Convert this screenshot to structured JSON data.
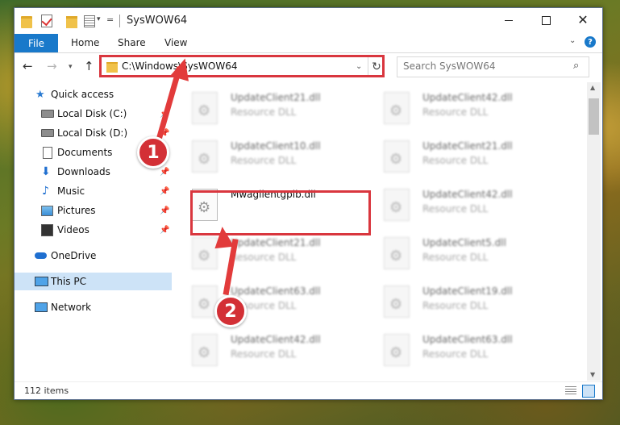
{
  "window": {
    "title": "SysWOW64",
    "controls": {
      "minimize": "minimize-icon",
      "maximize": "maximize-icon",
      "close": "close-icon"
    }
  },
  "ribbon": {
    "tabs": [
      "File",
      "Home",
      "Share",
      "View"
    ],
    "help": "?",
    "accent_color": "#1979ca"
  },
  "address": {
    "path": "C:\\Windows\\SysWOW64",
    "search_placeholder": "Search SysWOW64"
  },
  "sidebar": {
    "items": [
      {
        "label": "Quick access",
        "icon": "star-icon",
        "pinned": false
      },
      {
        "label": "Local Disk (C:)",
        "icon": "drive-icon",
        "pinned": true
      },
      {
        "label": "Local Disk (D:)",
        "icon": "drive-icon",
        "pinned": true
      },
      {
        "label": "Documents",
        "icon": "documents-icon",
        "pinned": true
      },
      {
        "label": "Downloads",
        "icon": "downloads-icon",
        "pinned": true
      },
      {
        "label": "Music",
        "icon": "music-icon",
        "pinned": true
      },
      {
        "label": "Pictures",
        "icon": "pictures-icon",
        "pinned": true
      },
      {
        "label": "Videos",
        "icon": "videos-icon",
        "pinned": true
      },
      {
        "label": "OneDrive",
        "icon": "onedrive-icon",
        "pinned": false
      },
      {
        "label": "This PC",
        "icon": "this-pc-icon",
        "pinned": false,
        "selected": true
      },
      {
        "label": "Network",
        "icon": "network-icon",
        "pinned": false
      }
    ]
  },
  "files": {
    "type_label": "Resource DLL",
    "items": [
      {
        "name": "UpdateClient21.dll",
        "type": "Resource DLL"
      },
      {
        "name": "UpdateClient42.dll",
        "type": "Resource DLL"
      },
      {
        "name": "UpdateClient10.dll",
        "type": "Resource DLL"
      },
      {
        "name": "UpdateClient21.dll",
        "type": "Resource DLL"
      },
      {
        "name": "Mwagilentgpib.dll",
        "type": ""
      },
      {
        "name": "UpdateClient42.dll",
        "type": "Resource DLL"
      },
      {
        "name": "UpdateClient21.dll",
        "type": "Resource DLL"
      },
      {
        "name": "UpdateClient5.dll",
        "type": "Resource DLL"
      },
      {
        "name": "UpdateClient63.dll",
        "type": "Resource DLL"
      },
      {
        "name": "UpdateClient19.dll",
        "type": "Resource DLL"
      },
      {
        "name": "UpdateClient42.dll",
        "type": "Resource DLL"
      },
      {
        "name": "UpdateClient63.dll",
        "type": "Resource DLL"
      }
    ]
  },
  "status": {
    "item_count": "112 items"
  },
  "annotations": {
    "step1": "1",
    "step2": "2",
    "highlight_color": "#d9363e"
  }
}
